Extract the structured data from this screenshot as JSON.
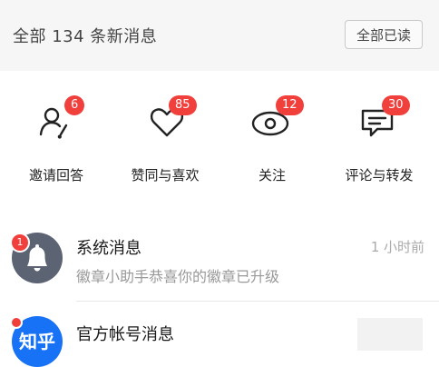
{
  "header": {
    "title": "全部 134 条新消息",
    "mark_all_read": "全部已读"
  },
  "categories": [
    {
      "label": "邀请回答",
      "badge": "6",
      "icon": "invite-answer-icon"
    },
    {
      "label": "赞同与喜欢",
      "badge": "85",
      "icon": "heart-icon"
    },
    {
      "label": "关注",
      "badge": "12",
      "icon": "eye-icon"
    },
    {
      "label": "评论与转发",
      "badge": "30",
      "icon": "comment-icon"
    }
  ],
  "messages": [
    {
      "title": "系统消息",
      "subtitle": "徽章小助手恭喜你的徽章已升级",
      "time": "1 小时前",
      "badge": "1",
      "avatar_color": "#5c6474",
      "icon": "bell-icon"
    },
    {
      "title": "官方帐号消息",
      "avatar_text": "知乎",
      "avatar_color": "#1772f6"
    }
  ],
  "colors": {
    "badge": "#f1403c",
    "brand": "#1772f6"
  }
}
